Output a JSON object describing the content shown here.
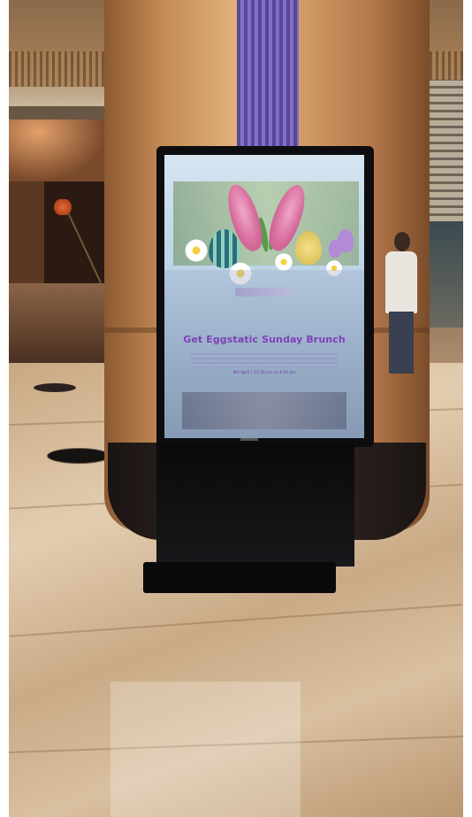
{
  "kiosk": {
    "headline": "Get Eggstatic Sunday Brunch",
    "date_line": "4th April | 12:30 pm to 4:00 pm"
  },
  "colors": {
    "headline": "#7e3fb7",
    "screen_bg": "#bcd4e6",
    "kiosk_frame": "#0d0d10",
    "floor": "#d9c0a0",
    "pillar": "#d39d68"
  },
  "icons": [
    "bunny-ears-icon",
    "easter-egg-icon",
    "daisy-icon",
    "tulip-icon"
  ]
}
